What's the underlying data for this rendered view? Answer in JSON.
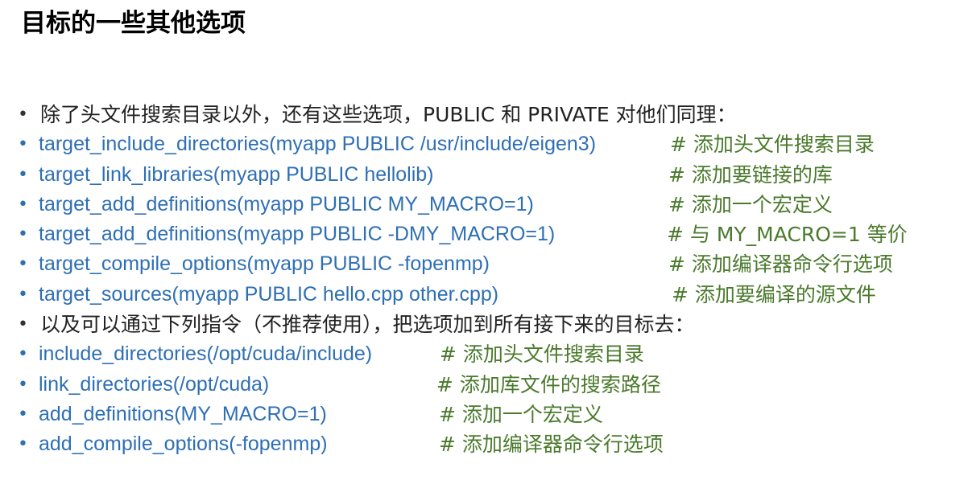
{
  "title": "目标的一些其他选项",
  "section1": {
    "intro": "除了头文件搜索目录以外，还有这些选项，PUBLIC 和 PRIVATE 对他们同理：",
    "items": [
      {
        "code": "target_include_directories(myapp PUBLIC /usr/include/eigen3)",
        "comment": "# 添加头文件搜索目录"
      },
      {
        "code": "target_link_libraries(myapp PUBLIC hellolib)",
        "comment": "# 添加要链接的库"
      },
      {
        "code": "target_add_definitions(myapp PUBLIC MY_MACRO=1)",
        "comment": "# 添加一个宏定义"
      },
      {
        "code": "target_add_definitions(myapp PUBLIC -DMY_MACRO=1)",
        "comment": "# 与 MY_MACRO=1 等价"
      },
      {
        "code": "target_compile_options(myapp PUBLIC -fopenmp)",
        "comment": "# 添加编译器命令行选项"
      },
      {
        "code": "target_sources(myapp PUBLIC hello.cpp other.cpp)",
        "comment": "# 添加要编译的源文件"
      }
    ]
  },
  "section2": {
    "intro": "以及可以通过下列指令（不推荐使用），把选项加到所有接下来的目标去：",
    "items": [
      {
        "code": "include_directories(/opt/cuda/include)",
        "comment": "# 添加头文件搜索目录"
      },
      {
        "code": "link_directories(/opt/cuda)",
        "comment": "# 添加库文件的搜索路径"
      },
      {
        "code": "add_definitions(MY_MACRO=1)",
        "comment": "# 添加一个宏定义"
      },
      {
        "code": "add_compile_options(-fopenmp)",
        "comment": "# 添加编译器命令行选项"
      }
    ]
  },
  "colors": {
    "code": "#2e6fb4",
    "comment": "#4a7a2c",
    "text": "#222222"
  }
}
